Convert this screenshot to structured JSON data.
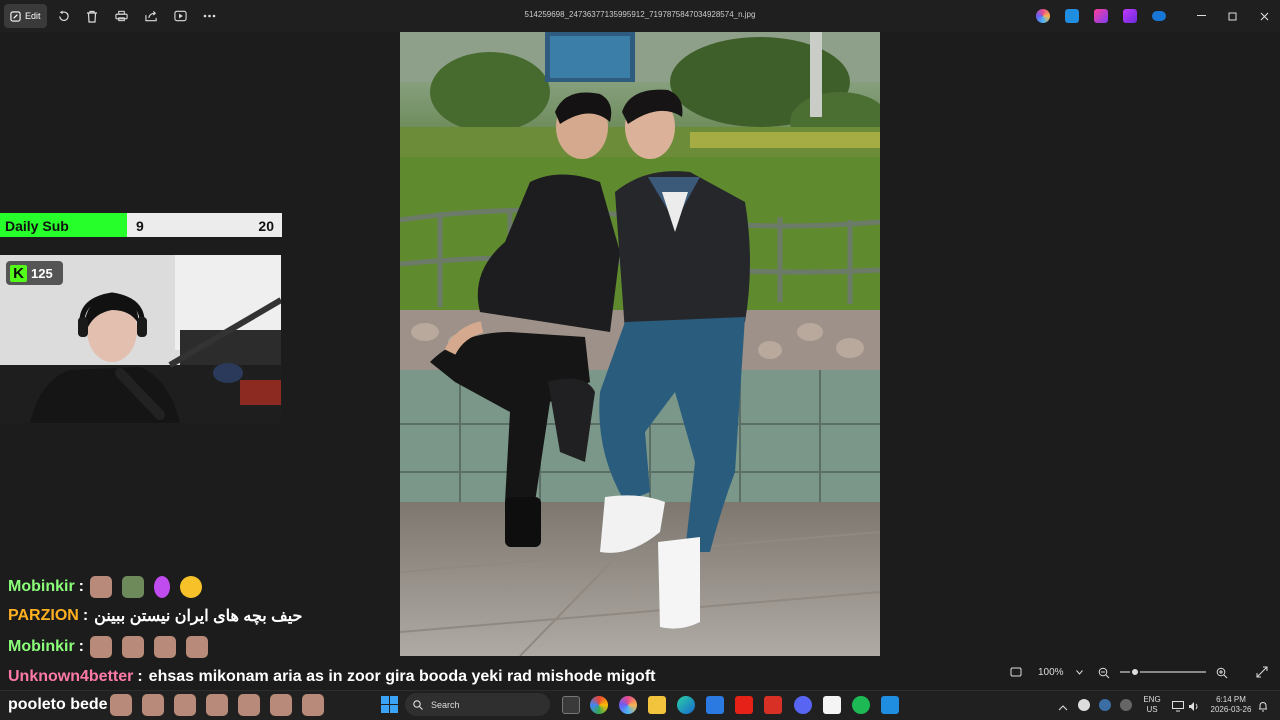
{
  "toolbar": {
    "edit_label": "Edit",
    "filename": "514259698_24736377135995912_7197875847034928574_n.jpg"
  },
  "daily_sub": {
    "label": "Daily Sub",
    "current": "9",
    "goal": "20",
    "progress_fraction": 0.45,
    "fill_color": "#26ff2a"
  },
  "kick": {
    "badge_letter": "K",
    "viewer_count": "125",
    "brand_color": "#53fc18"
  },
  "chat": [
    {
      "user": "Mobinkir",
      "colon": ":",
      "message": "",
      "emotes": 4,
      "user_color": "#8cff7a"
    },
    {
      "user": "PARZION",
      "colon": ":",
      "message": "حیف بچه های ایران نیستن ببینن",
      "emotes": 0,
      "user_color": "#ffb020"
    },
    {
      "user": "Mobinkir",
      "colon": ":",
      "message": "",
      "emotes": 4,
      "user_color": "#8cff7a"
    },
    {
      "user": "Unknown4better",
      "colon": ":",
      "message": "ehsas mikonam aria as in zoor gira booda yeki rad mishode migoft",
      "emotes": 0,
      "user_color": "#ff7aa8"
    },
    {
      "user": "",
      "colon": "",
      "message": "pooleto bede",
      "emotes": 7,
      "user_color": "#ffffff"
    }
  ],
  "viewer_bar": {
    "zoom_label": "100%"
  },
  "taskbar": {
    "search_placeholder": "Search",
    "lang_top": "ENG",
    "lang_bottom": "US",
    "time": "6:14 PM",
    "date": "2026-03-26"
  }
}
